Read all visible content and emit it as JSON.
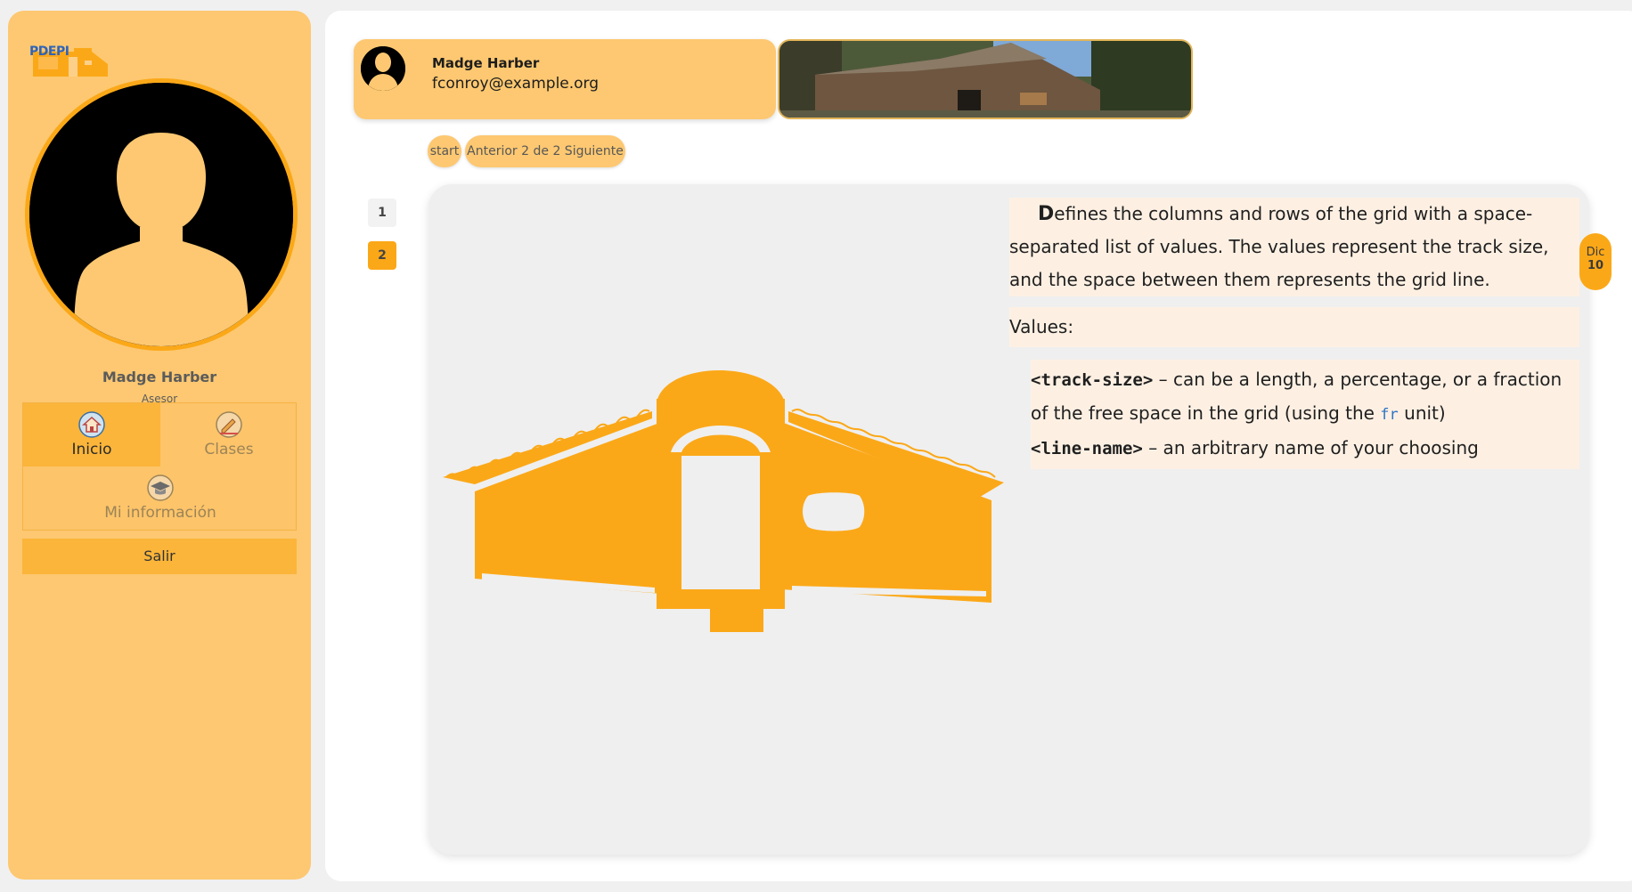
{
  "app": {
    "logo_text": "PDEPI"
  },
  "profile": {
    "name": "Madge Harber",
    "role": "Asesor"
  },
  "menu": {
    "items": [
      {
        "label": "Inicio",
        "icon": "home-icon",
        "active": true
      },
      {
        "label": "Clases",
        "icon": "pencil-icon",
        "active": false
      },
      {
        "label": "Mi información",
        "icon": "graduation-cap-icon",
        "active": false
      }
    ],
    "logout_label": "Salir"
  },
  "user_card": {
    "name": "Madge Harber",
    "email": "fconroy@example.org"
  },
  "pager": {
    "start_label": "start",
    "nav_label": "Anterior 2 de 2 Siguiente"
  },
  "pages": [
    "1",
    "2"
  ],
  "current_page": "2",
  "content": {
    "dropcap": "D",
    "intro": "efines the columns and rows of the grid with a space-separated list of values. The values represent the track size, and the space between them represents the grid line.",
    "values_label": "Values:",
    "items": [
      {
        "code": "<track-size>",
        "text_before": " – can be a length, a percentage, or a fraction of the free space in the grid (using the ",
        "code_inline": "fr",
        "text_after": " unit)"
      },
      {
        "code": "<line-name>",
        "text": " – an arbitrary name of your choosing"
      }
    ]
  },
  "date_badge": {
    "month": "Dic",
    "day": "10"
  },
  "colors": {
    "accent": "#fba818",
    "sidebar_bg": "#fdc871",
    "highlight": "#fdf0e3"
  }
}
